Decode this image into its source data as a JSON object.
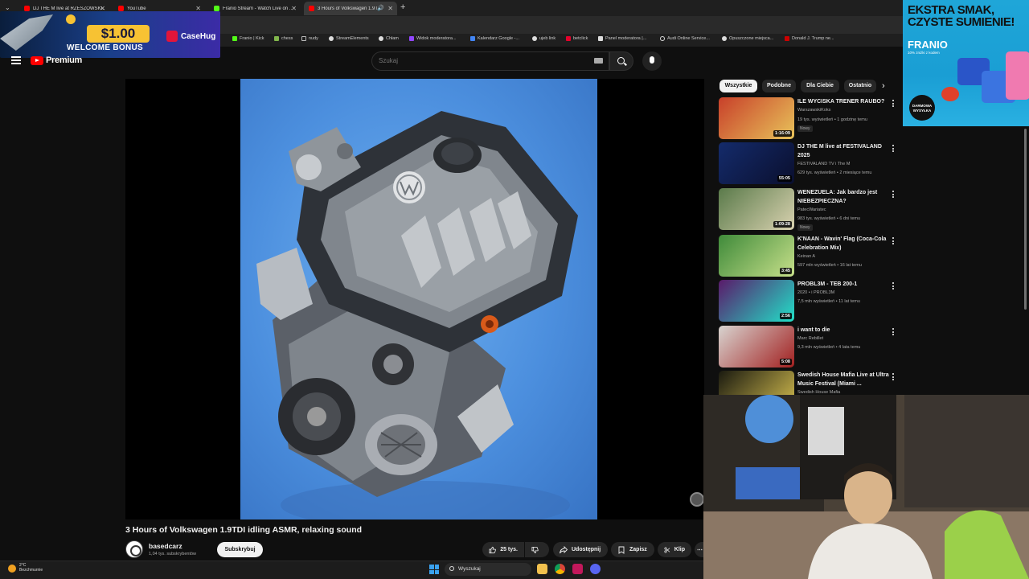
{
  "browser": {
    "tabs": [
      {
        "title": "DJ THE M live at RZESZOWSKI...",
        "favicon_color": "#ff0000",
        "active": false
      },
      {
        "title": "YouTube",
        "favicon_color": "#ff0000",
        "active": false
      },
      {
        "title": "Franio Stream - Watch Live on ...",
        "favicon_color": "#53fc18",
        "active": false
      },
      {
        "title": "3 Hours of Volkswagen 1.9T...",
        "favicon_color": "#ff0000",
        "active": true
      }
    ],
    "new_tab_icon": "plus-icon",
    "bookmarks": [
      {
        "label": "Franio | Kick",
        "color": "#53fc18"
      },
      {
        "label": "chess",
        "color": "#81b64c"
      },
      {
        "label": "nudy",
        "color": "#bbbbbb"
      },
      {
        "label": "StreamElements",
        "color": "#dddddd"
      },
      {
        "label": "Chłam",
        "color": "#dddddd"
      },
      {
        "label": "Widok moderatora...",
        "color": "#9146ff"
      },
      {
        "label": "Kalendarz Google -...",
        "color": "#4285f4"
      },
      {
        "label": "ujeb link",
        "color": "#dddddd"
      },
      {
        "label": "betclick",
        "color": "#e4002b"
      },
      {
        "label": "Panel moderatora |...",
        "color": "#dddddd"
      },
      {
        "label": "Audi Online Service...",
        "color": "#dddddd"
      },
      {
        "label": "Opuszczone miejsca...",
        "color": "#dddddd"
      },
      {
        "label": "Donald J. Trump ne...",
        "color": "#cc0000"
      }
    ]
  },
  "casino_ad": {
    "amount": "$1.00",
    "text": "WELCOME BONUS",
    "brand": "CaseHug"
  },
  "youtube": {
    "logo_text": "Premium",
    "search_placeholder": "Szukaj",
    "video_title": "3 Hours of Volkswagen 1.9TDI idling ASMR, relaxing sound",
    "channel": {
      "name": "basedcarz",
      "subscribers": "1,04 tys. subskrybentów",
      "subscribe_label": "Subskrybuj"
    },
    "actions": {
      "likes": "25 tys.",
      "share": "Udostępnij",
      "save": "Zapisz",
      "clip": "Klip"
    },
    "chips": [
      "Wszystkie",
      "Podobne",
      "Dla Ciebie",
      "Ostatnio"
    ],
    "recommendations": [
      {
        "title": "ILE WYCISKA TRENER RAUBO?",
        "channel": "WarszawskiKoks",
        "verified": true,
        "meta": "19 tys. wyświetleń • 1 godzinę temu",
        "badge": "Nowy",
        "duration": "1:16:09",
        "thumb": [
          "#c8402a",
          "#e8c35a"
        ]
      },
      {
        "title": "DJ THE M live at FESTIVALAND 2025",
        "channel": "FESTIVALAND TV i The M",
        "verified": false,
        "meta": "629 tys. wyświetleń • 2 miesiące temu",
        "badge": "",
        "duration": "55:05",
        "thumb": [
          "#142b6b",
          "#0a0f2e"
        ]
      },
      {
        "title": "WENEZUELA: Jak bardzo jest NIEBEZPIECZNA?",
        "channel": "PatecWariatec",
        "verified": true,
        "meta": "983 tys. wyświetleń • 6 dni temu",
        "badge": "Nowy",
        "duration": "1:09:28",
        "thumb": [
          "#5a7a4a",
          "#d9d2b0"
        ]
      },
      {
        "title": "K'NAAN - Wavin' Flag (Coca-Cola Celebration Mix)",
        "channel": "Keinan A",
        "verified": true,
        "meta": "597 mln wyświetleń • 16 lat temu",
        "badge": "",
        "duration": "3:45",
        "thumb": [
          "#3f8a3a",
          "#c7e08a"
        ]
      },
      {
        "title": "PROBL3M - TEB 200-1",
        "channel": "2020 • i PROBL3M",
        "verified": true,
        "meta": "7,5 mln wyświetleń • 11 lat temu",
        "badge": "",
        "duration": "2:56",
        "thumb": [
          "#5a1a6a",
          "#22e0c8"
        ]
      },
      {
        "title": "i want to die",
        "channel": "Marc Rebillet",
        "verified": true,
        "meta": "9,3 mln wyświetleń • 4 lata temu",
        "badge": "",
        "duration": "5:08",
        "thumb": [
          "#d8d4d0",
          "#a22020"
        ]
      },
      {
        "title": "Swedish House Mafia Live at Ultra Music Festival (Miami ...",
        "channel": "Swedish House Mafia",
        "verified": true,
        "meta": "",
        "badge": "",
        "duration": "",
        "thumb": [
          "#1a1a10",
          "#d7c050"
        ]
      }
    ]
  },
  "side_ad": {
    "headline": "EKSTRA SMAK, CZYSTE SUMIENIE!",
    "brand": "FRANIO",
    "small": "10% zniżki z kodem",
    "badge": "DARMOWA WYSYŁKA"
  },
  "taskbar": {
    "weather_temp": "2°C",
    "weather_desc": "Bezchmurnie",
    "search_label": "Wyszukaj"
  },
  "colors": {
    "youtube_red": "#ff0000",
    "bg": "#0f0f0f",
    "video_bg": "#4c8fde"
  }
}
